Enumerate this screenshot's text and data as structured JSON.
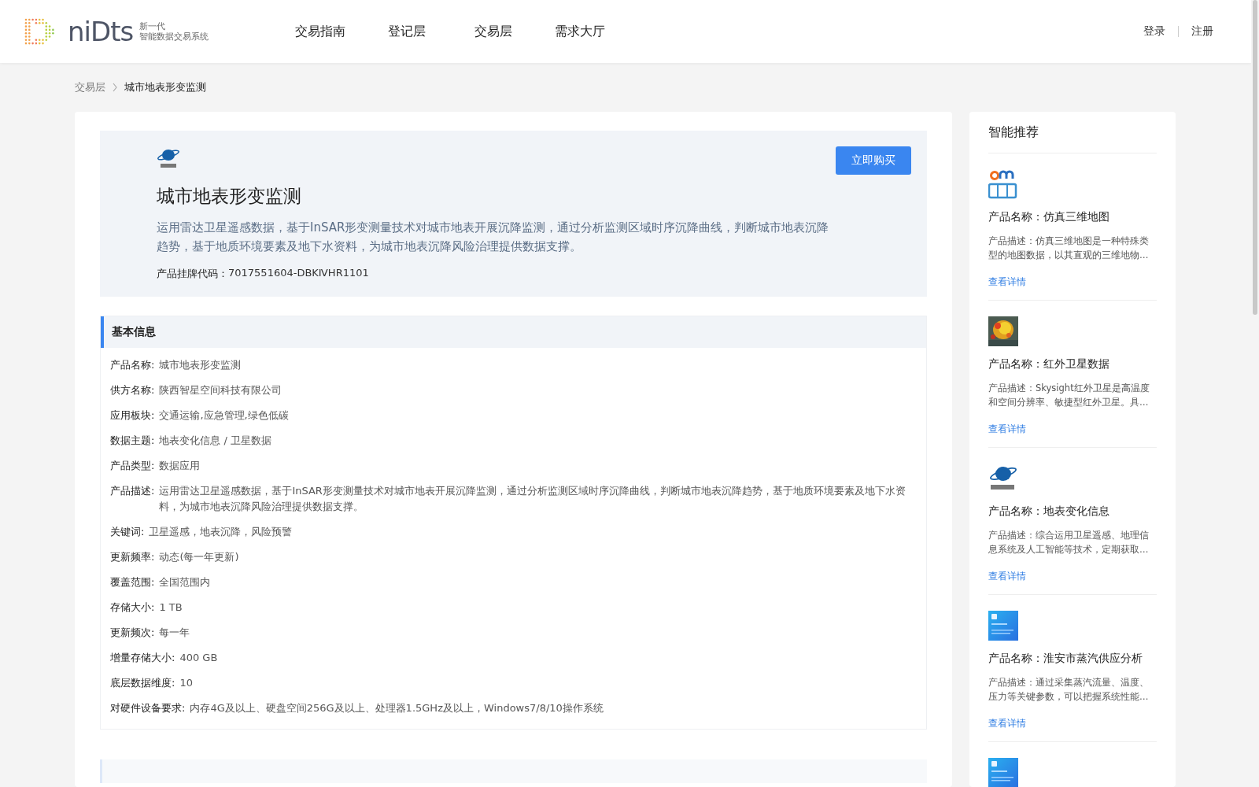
{
  "header": {
    "logo_text": "niDts",
    "logo_tagline_1": "新一代",
    "logo_tagline_2": "智能数据交易系统",
    "nav": [
      {
        "label": "交易指南"
      },
      {
        "label": "登记层"
      },
      {
        "label": "交易层"
      },
      {
        "label": "需求大厅"
      }
    ],
    "auth": [
      "登录",
      "注册"
    ]
  },
  "breadcrumb": [
    "交易层",
    "城市地表形变监测"
  ],
  "product": {
    "title": "城市地表形变监测",
    "description": "运用雷达卫星遥感数据，基于InSAR形变测量技术对城市地表开展沉降监测，通过分析监测区域时序沉降曲线，判断城市地表沉降趋势，基于地质环境要素及地下水资料，为城市地表沉降风险治理提供数据支撑。",
    "code_label": "产品挂牌代码：",
    "code": "7017551604-DBKⅣHR1101",
    "buy_button": "立即购买"
  },
  "basic_info": {
    "title": "基本信息",
    "fields": [
      {
        "label": "产品名称:",
        "value": "城市地表形变监测"
      },
      {
        "label": "供方名称:",
        "value": "陕西智星空间科技有限公司"
      },
      {
        "label": "应用板块:",
        "value": "交通运输,应急管理,绿色低碳"
      },
      {
        "label": "数据主题:",
        "value": "地表变化信息 / 卫星数据"
      },
      {
        "label": "产品类型:",
        "value": "数据应用"
      },
      {
        "label": "产品描述:",
        "value": "运用雷达卫星遥感数据，基于InSAR形变测量技术对城市地表开展沉降监测，通过分析监测区域时序沉降曲线，判断城市地表沉降趋势，基于地质环境要素及地下水资料，为城市地表沉降风险治理提供数据支撑。"
      },
      {
        "label": "关键词:",
        "value": "卫星遥感，地表沉降，风险预警"
      },
      {
        "label": "更新频率:",
        "value": "动态(每一年更新)"
      },
      {
        "label": "覆盖范围:",
        "value": "全国范围内"
      },
      {
        "label": "存储大小:",
        "value": "1 TB"
      },
      {
        "label": "更新频次:",
        "value": "每一年"
      },
      {
        "label": "增量存储大小:",
        "value": "400 GB"
      },
      {
        "label": "底层数据维度:",
        "value": "10"
      },
      {
        "label": "对硬件设备要求:",
        "value": "内存4G及以上、硬盘空间256G及以上、处理器1.5GHz及以上，Windows7/8/10操作系统"
      }
    ]
  },
  "recommendations": {
    "title": "智能推荐",
    "items": [
      {
        "kind": "city-logo",
        "name": "产品名称：仿真三维地图",
        "description": "产品描述：仿真三维地图是一种特殊类型的地图数据，以其直观的三维地物…",
        "link": "查看详情"
      },
      {
        "name": "产品名称：红外卫星数据",
        "description": "产品描述：Skysight红外卫星是高温度和空间分辨率、敏捷型红外卫星。具…",
        "link": "查看详情"
      },
      {
        "kind": "planet-logo",
        "name": "产品名称：地表变化信息",
        "description": "产品描述：综合运用卫星遥感、地理信息系统及人工智能等技术，定期获取…",
        "link": "查看详情"
      },
      {
        "kind": "blue-card",
        "name": "产品名称：淮安市蒸汽供应分析",
        "description": "产品描述：通过采集蒸汽流量、温度、压力等关键参数，可以把握系统性能…",
        "link": "查看详情"
      },
      {
        "kind": "blue-card"
      }
    ]
  }
}
